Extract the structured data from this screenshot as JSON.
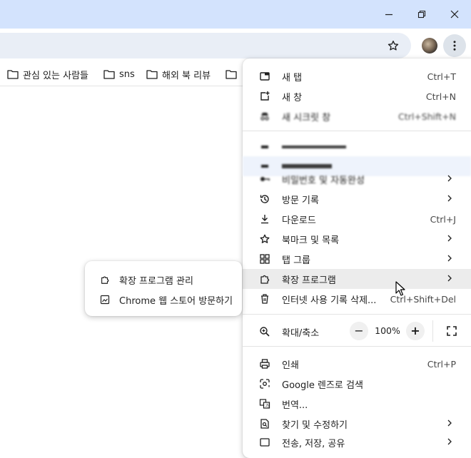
{
  "window_controls": {
    "minimize": "minimize-icon",
    "restore": "restore-icon",
    "close": "close-icon"
  },
  "bookmarks": [
    {
      "label": "관심 있는 사람들"
    },
    {
      "label": "sns"
    },
    {
      "label": "해외 북 리뷰"
    }
  ],
  "menu": {
    "new_tab": {
      "label": "새 탭",
      "shortcut": "Ctrl+T"
    },
    "new_window": {
      "label": "새 창",
      "shortcut": "Ctrl+N"
    },
    "incognito": {
      "label": "새 시크릿 창",
      "shortcut": "Ctrl+Shift+N"
    },
    "autofill": {
      "label": "비밀번호 및 자동완성"
    },
    "history": {
      "label": "방문 기록"
    },
    "downloads": {
      "label": "다운로드",
      "shortcut": "Ctrl+J"
    },
    "bookmarks": {
      "label": "북마크 및 목록"
    },
    "tab_groups": {
      "label": "탭 그룹"
    },
    "extensions": {
      "label": "확장 프로그램"
    },
    "clear_data": {
      "label": "인터넷 사용 기록 삭제...",
      "shortcut": "Ctrl+Shift+Del"
    },
    "zoom": {
      "label": "확대/축소",
      "minus": "−",
      "value": "100%",
      "plus": "+"
    },
    "print": {
      "label": "인쇄",
      "shortcut": "Ctrl+P"
    },
    "lens": {
      "label": "Google 렌즈로 검색"
    },
    "translate": {
      "label": "번역..."
    },
    "find_edit": {
      "label": "찾기 및 수정하기"
    },
    "cast_save_share": {
      "label": "전송, 저장, 공유"
    }
  },
  "submenu": {
    "manage_extensions": {
      "label": "확장 프로그램 관리"
    },
    "web_store": {
      "label": "Chrome 웹 스토어 방문하기"
    }
  }
}
